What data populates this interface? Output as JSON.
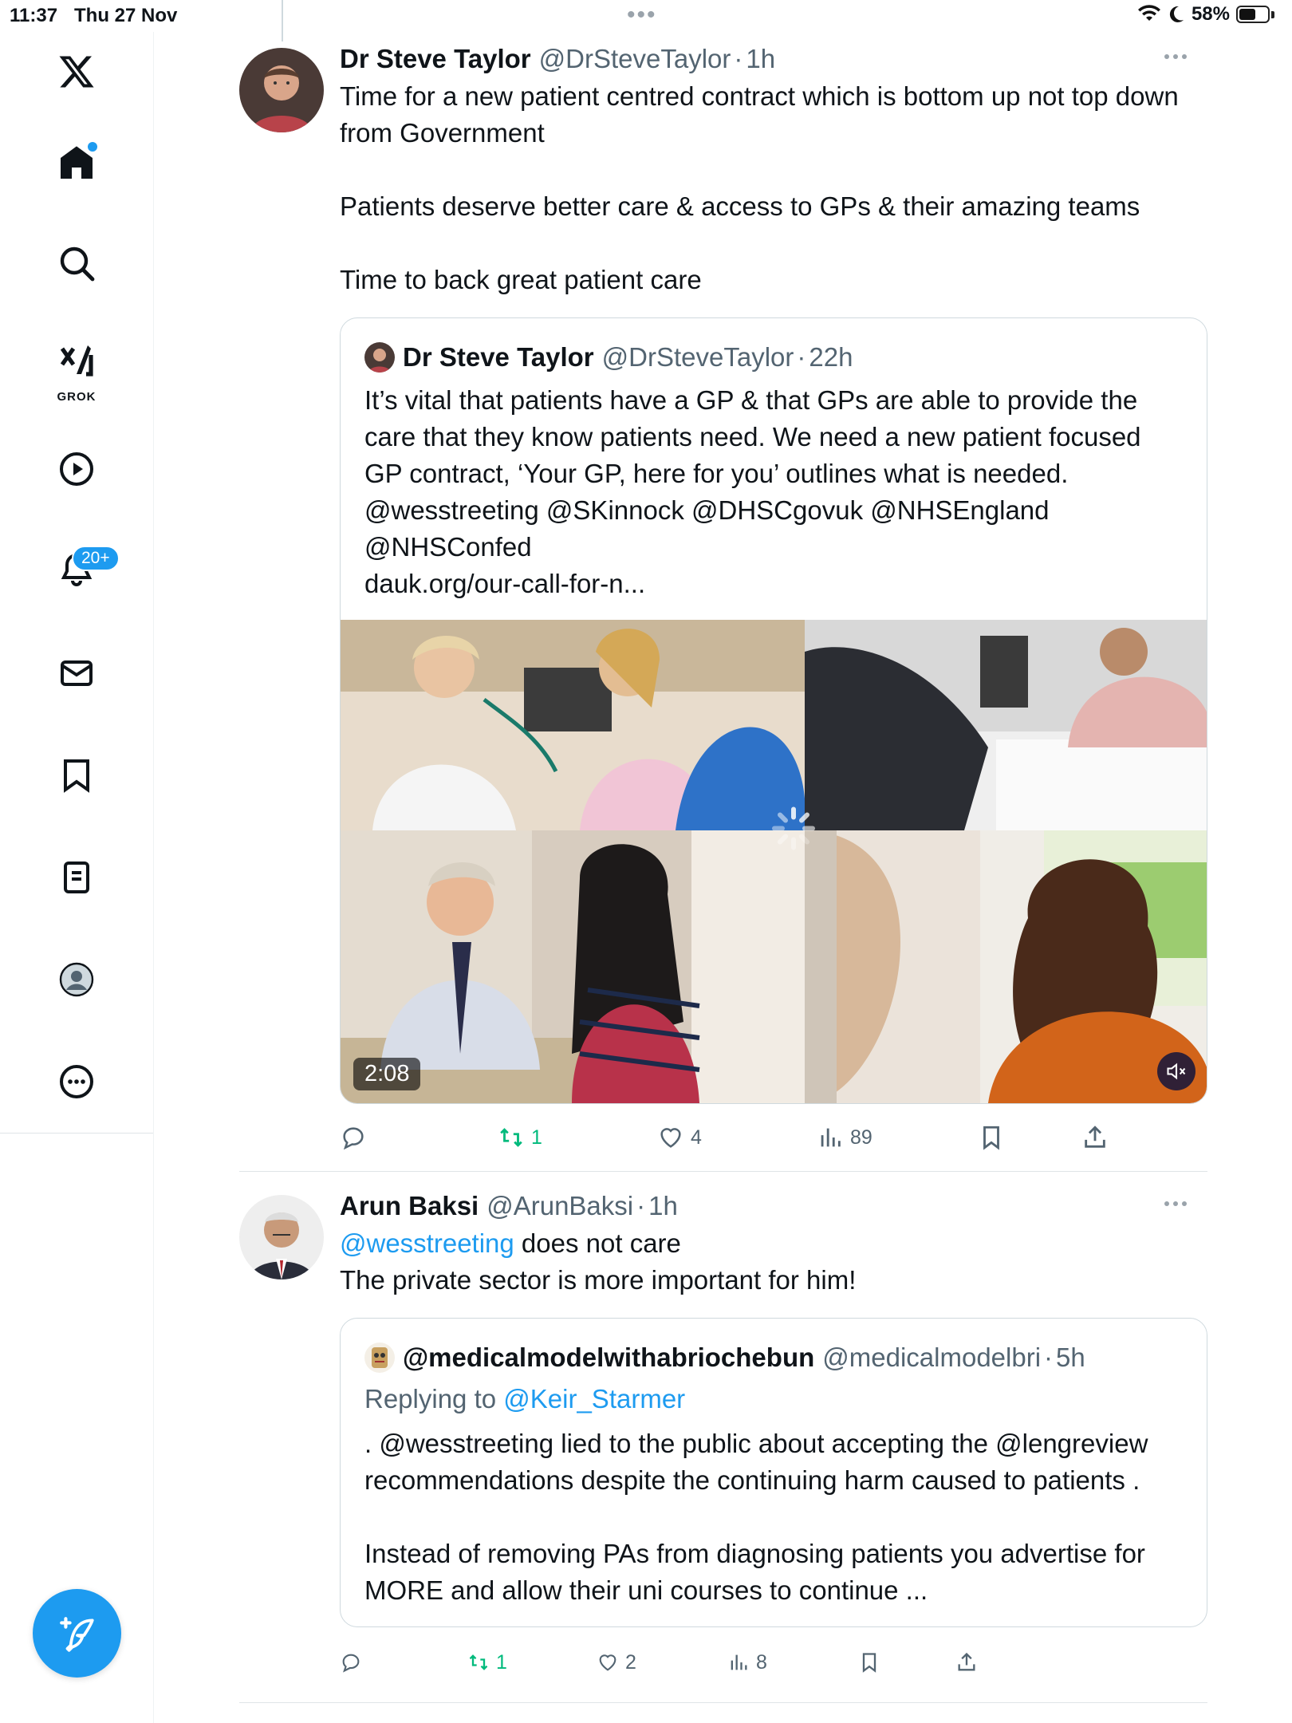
{
  "status_bar": {
    "time": "11:37",
    "date": "Thu 27 Nov",
    "battery": "58%",
    "battery_level": 0.58
  },
  "sidebar": {
    "items": [
      {
        "id": "logo",
        "icon": "x-logo-icon"
      },
      {
        "id": "home",
        "icon": "home-icon"
      },
      {
        "id": "explore",
        "icon": "search-icon"
      },
      {
        "id": "grok",
        "icon": "grok-icon",
        "label": "GROK"
      },
      {
        "id": "video",
        "icon": "play-icon"
      },
      {
        "id": "notifications",
        "icon": "bell-icon",
        "badge": "20+"
      },
      {
        "id": "messages",
        "icon": "mail-icon"
      },
      {
        "id": "bookmarks",
        "icon": "bookmark-icon"
      },
      {
        "id": "lists",
        "icon": "list-icon"
      },
      {
        "id": "profile",
        "icon": "profile-icon"
      },
      {
        "id": "more",
        "icon": "more-circle-icon"
      }
    ],
    "compose_icon": "compose-icon"
  },
  "tweets": [
    {
      "name": "Dr Steve Taylor",
      "handle": "@DrSteveTaylor",
      "dot": "·",
      "time": "1h",
      "text": "Time for a new patient centred contract which is bottom up not top down from Government\n\nPatients deserve better care & access to GPs & their amazing teams\n\nTime to back great patient care",
      "quote": {
        "name": "Dr Steve Taylor",
        "handle": "@DrSteveTaylor",
        "dot": "·",
        "time": "22h",
        "text": "It’s vital that patients have a GP & that GPs are able to provide the care that they know patients need. We need a new patient focused GP contract, ‘Your GP, here for you’ outlines what is needed. @wesstreeting @SKinnock @DHSCgovuk @NHSEngland @NHSConfed\ndauk.org/our-call-for-n...",
        "video_duration": "2:08"
      },
      "stats": {
        "replies": "",
        "reposts": "1",
        "likes": "4",
        "views": "89"
      }
    },
    {
      "name": "Arun Baksi",
      "handle": "@ArunBaksi",
      "dot": "·",
      "time": "1h",
      "text_mention": "@wesstreeting",
      "text_rest": " does not care\nThe private sector is more important for him!",
      "quote": {
        "name": "@medicalmodelwithabriochebun",
        "handle": "@medicalmodelbri",
        "dot": "·",
        "time": "5h",
        "replying_prefix": "Replying to ",
        "replying_to": "@Keir_Starmer",
        "text": ". @wesstreeting lied to the public about accepting the @lengreview recommendations despite the continuing harm caused to patients .\n\nInstead of removing PAs from diagnosing patients you advertise for MORE and allow their uni courses to continue ..."
      },
      "stats": {
        "replies": "",
        "reposts": "1",
        "likes": "2",
        "views": "8"
      }
    }
  ]
}
